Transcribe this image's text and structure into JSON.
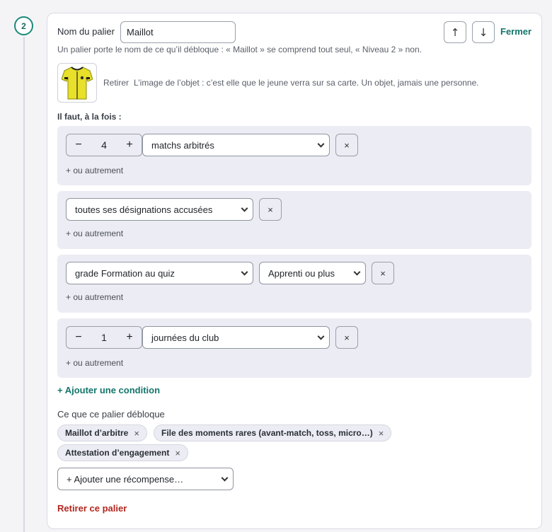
{
  "step": {
    "number": "2"
  },
  "tier": {
    "name_label": "Nom du palier",
    "name_value": "Maillot",
    "move_up_icon": "↑",
    "move_down_icon": "↓",
    "close_label": "Fermer",
    "hint": "Un palier porte le nom de ce qu’il débloque : « Maillot » se comprend tout seul, « Niveau 2 » non.",
    "image_remove": "Retirer",
    "image_hint": "L’image de l’objet : c’est elle que le jeune verra sur sa carte. Un objet, jamais une personne.",
    "image_subject": "yellow-referee-jersey"
  },
  "conditions": {
    "label": "Il faut, à la fois :",
    "or_label": "+ ou autrement",
    "remove_icon": "×",
    "minus_icon": "−",
    "plus_icon": "+",
    "items": [
      {
        "count": "4",
        "select": "matchs arbitrés"
      },
      {
        "select": "toutes ses désignations accusées"
      },
      {
        "select": "grade Formation au quiz",
        "select2": "Apprenti ou plus"
      },
      {
        "count": "1",
        "select": "journées du club"
      }
    ],
    "add_label": "+ Ajouter une condition"
  },
  "rewards": {
    "label": "Ce que ce palier débloque",
    "chip_remove_icon": "×",
    "chips": [
      "Maillot d’arbitre",
      "File des moments rares (avant-match, toss, micro…)",
      "Attestation d’engagement"
    ],
    "add_select": "+ Ajouter une récompense…"
  },
  "remove_tier": "Retirer ce palier",
  "colors": {
    "accent": "#14756a",
    "danger": "#b3261e",
    "jersey": "#e8e02a"
  }
}
